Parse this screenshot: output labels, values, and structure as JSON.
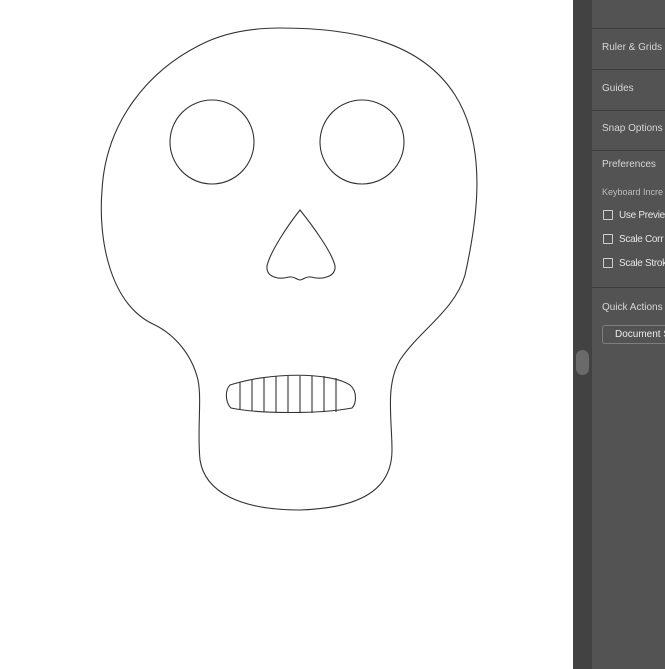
{
  "canvas": {
    "artwork": "skull-outline",
    "colors": {
      "background": "#ffffff",
      "stroke": "#333333"
    }
  },
  "panel": {
    "sections": {
      "ruler_grids": "Ruler & Grids",
      "guides": "Guides",
      "snap_options": "Snap Options",
      "preferences": "Preferences"
    },
    "keyboard_increment_label": "Keyboard Incre",
    "checkboxes": [
      {
        "label": "Use Previe",
        "checked": false
      },
      {
        "label": "Scale Corr",
        "checked": false
      },
      {
        "label": "Scale Strok",
        "checked": false
      }
    ],
    "quick_actions": {
      "title": "Quick Actions",
      "document_setup_button": "Document S"
    },
    "colors": {
      "panel_bg": "#535353",
      "scroll_rail": "#424242",
      "text": "#d6d6d6"
    }
  }
}
